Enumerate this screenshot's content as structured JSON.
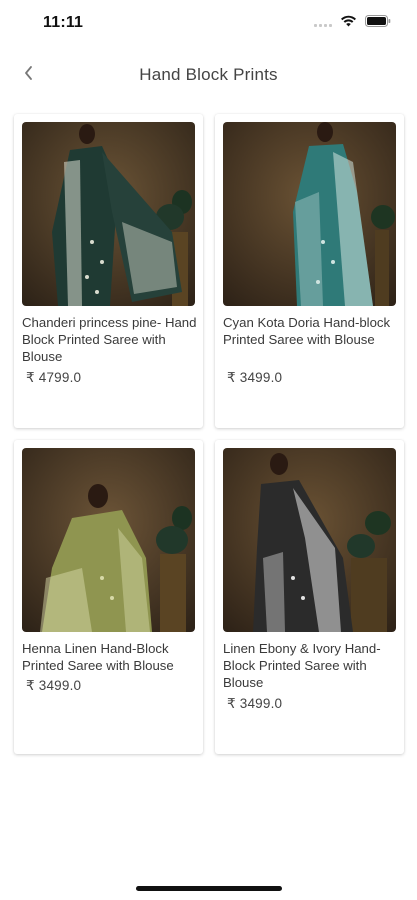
{
  "status_bar": {
    "time": "11:11"
  },
  "header": {
    "title": "Hand Block Prints"
  },
  "products": [
    {
      "title": "Chanderi princess pine- Hand Block Printed Saree with Blouse",
      "price": "₹ 4799.0",
      "saree_color": "#1f3a33",
      "print_color": "#d9dccf"
    },
    {
      "title": "Cyan Kota Doria Hand-block Printed Saree with Blouse",
      "price": "₹ 3499.0",
      "saree_color": "#2f7a78",
      "print_color": "#cfe3df"
    },
    {
      "title": "Henna Linen Hand-Block Printed Saree with Blouse",
      "price": "₹ 3499.0",
      "saree_color": "#8f9550",
      "print_color": "#d7d9a8"
    },
    {
      "title": "Linen Ebony & Ivory Hand-Block Printed Saree with Blouse",
      "price": "₹ 3499.0",
      "saree_color": "#2b2b2b",
      "print_color": "#e3e3e3"
    }
  ]
}
